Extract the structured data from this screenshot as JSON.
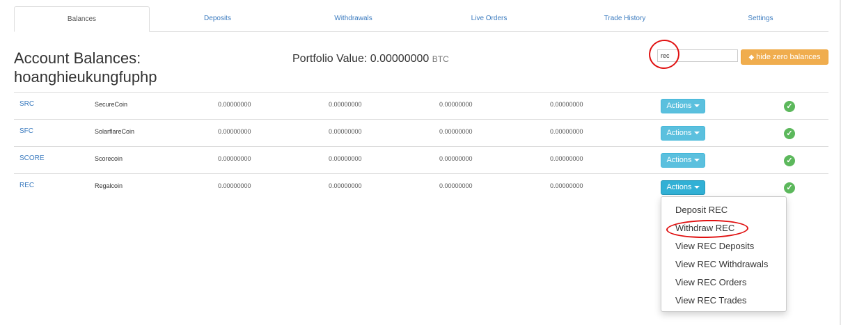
{
  "tabs": [
    {
      "label": "Balances",
      "active": true
    },
    {
      "label": "Deposits"
    },
    {
      "label": "Withdrawals"
    },
    {
      "label": "Live Orders"
    },
    {
      "label": "Trade History"
    },
    {
      "label": "Settings"
    }
  ],
  "header": {
    "title_line1": "Account Balances:",
    "title_line2": "hoanghieukungfuphp",
    "portfolio_label": "Portfolio Value: 0.00000000",
    "portfolio_unit": "BTC"
  },
  "filter": {
    "search_value": "rec",
    "hide_zero_label": "hide zero balances"
  },
  "balances": [
    {
      "code": "SRC",
      "name": "SecureCoin",
      "values": [
        "0.00000000",
        "0.00000000",
        "0.00000000",
        "0.00000000"
      ],
      "action_label": "Actions"
    },
    {
      "code": "SFC",
      "name": "SolarflareCoin",
      "values": [
        "0.00000000",
        "0.00000000",
        "0.00000000",
        "0.00000000"
      ],
      "action_label": "Actions"
    },
    {
      "code": "SCORE",
      "name": "Scorecoin",
      "values": [
        "0.00000000",
        "0.00000000",
        "0.00000000",
        "0.00000000"
      ],
      "action_label": "Actions"
    },
    {
      "code": "REC",
      "name": "Regalcoin",
      "values": [
        "0.00000000",
        "0.00000000",
        "0.00000000",
        "0.00000000"
      ],
      "action_label": "Actions"
    }
  ],
  "dropdown": {
    "items": [
      "Deposit REC",
      "Withdraw REC",
      "View REC Deposits",
      "View REC Withdrawals",
      "View REC Orders",
      "View REC Trades"
    ]
  },
  "colors": {
    "link": "#3b7bbf",
    "info_button": "#5bc0de",
    "warning_button": "#f0ad4e",
    "success_check": "#5cb85c",
    "annotation_red": "#e01010"
  }
}
